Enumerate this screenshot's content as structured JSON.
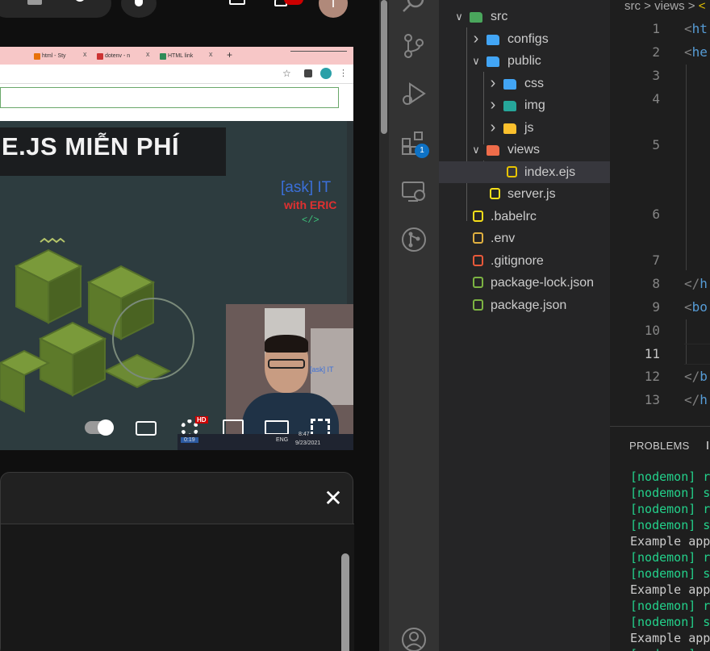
{
  "youtube": {
    "controls": {
      "hd_badge": "HD",
      "time_taskbar": "0:19",
      "clock": "8:47",
      "date": "9/23/2021",
      "lang": "ENG"
    },
    "avatar_letter": "T",
    "progress_fraction": 0.65,
    "close_glyph": "✕"
  },
  "browser": {
    "tabs": [
      {
        "label": "html - Sty",
        "color": "#e8710a"
      },
      {
        "label": "dotenv - n",
        "color": "#cc3333"
      },
      {
        "label": "HTML link",
        "color": "#2e8b57"
      }
    ],
    "tab_close": "x",
    "new_tab": "+"
  },
  "slide": {
    "title": "E.JS MIỄN PHÍ",
    "brand_line1": "[ask] IT",
    "brand_line2": "with ERIC",
    "brand_code": "</>",
    "webcam_text": "[ask] IT"
  },
  "explorer": {
    "items": [
      {
        "label": "src",
        "chevron": "v",
        "icon": "folder-src",
        "color": "#4aa65c",
        "depth": 0
      },
      {
        "label": "configs",
        "chevron": ">",
        "icon": "folder-config",
        "color": "#42a5f5",
        "depth": 1
      },
      {
        "label": "public",
        "chevron": "v",
        "icon": "folder-public",
        "color": "#42a5f5",
        "depth": 1
      },
      {
        "label": "css",
        "chevron": ">",
        "icon": "folder-css",
        "color": "#42a5f5",
        "depth": 2
      },
      {
        "label": "img",
        "chevron": ">",
        "icon": "folder-img",
        "color": "#26a69a",
        "depth": 2
      },
      {
        "label": "js",
        "chevron": ">",
        "icon": "folder-js",
        "color": "#fbc02d",
        "depth": 2
      },
      {
        "label": "views",
        "chevron": "v",
        "icon": "folder-views",
        "color": "#ef6c4a",
        "depth": 1
      },
      {
        "label": "index.ejs",
        "chevron": "",
        "icon": "ejs-file",
        "color": "#e8c400",
        "depth": 2
      },
      {
        "label": "server.js",
        "chevron": "",
        "icon": "js-file",
        "color": "#f5de19",
        "depth": 1
      },
      {
        "label": ".babelrc",
        "chevron": "",
        "icon": "babel-file",
        "color": "#f5de19",
        "depth": 0
      },
      {
        "label": ".env",
        "chevron": "",
        "icon": "env-file",
        "color": "#e0b040",
        "depth": 0
      },
      {
        "label": ".gitignore",
        "chevron": "",
        "icon": "git-file",
        "color": "#e8593a",
        "depth": 0
      },
      {
        "label": "package-lock.json",
        "chevron": "",
        "icon": "node-file",
        "color": "#7cb342",
        "depth": 0
      },
      {
        "label": "package.json",
        "chevron": "",
        "icon": "node-file",
        "color": "#7cb342",
        "depth": 0
      }
    ],
    "selected": "index.ejs"
  },
  "activity_bar": {
    "extensions_badge": "1"
  },
  "editor": {
    "breadcrumb": [
      "src",
      ">",
      "views",
      ">"
    ],
    "line_numbers": [
      "1",
      "2",
      "3",
      "4",
      "5",
      "6",
      "7",
      "8",
      "9",
      "10",
      "11",
      "12",
      "13"
    ],
    "active_line": "11",
    "code": [
      {
        "line": 1,
        "prefix": "<",
        "tag": "ht"
      },
      {
        "line": 2,
        "prefix": "<",
        "tag": "he"
      },
      {
        "line": 8,
        "prefix": "</",
        "tag": "h"
      },
      {
        "line": 9,
        "prefix": "<",
        "tag": "bo"
      },
      {
        "line": 12,
        "prefix": "</",
        "tag": "b"
      },
      {
        "line": 13,
        "prefix": "</",
        "tag": "h"
      }
    ]
  },
  "panel": {
    "tab": "PROBLEMS",
    "terminal": [
      {
        "text": "[nodemon] r",
        "color": "green"
      },
      {
        "text": "[nodemon] s",
        "color": "green"
      },
      {
        "text": "[nodemon] r",
        "color": "green"
      },
      {
        "text": "[nodemon] s",
        "color": "green"
      },
      {
        "text": "Example app",
        "color": "white"
      },
      {
        "text": "[nodemon] r",
        "color": "green"
      },
      {
        "text": "[nodemon] s",
        "color": "green"
      },
      {
        "text": "Example app",
        "color": "white"
      },
      {
        "text": "[nodemon] r",
        "color": "green"
      },
      {
        "text": "[nodemon] s",
        "color": "green"
      },
      {
        "text": "Example app",
        "color": "white"
      },
      {
        "text": "[nodemon] r",
        "color": "green"
      }
    ]
  }
}
